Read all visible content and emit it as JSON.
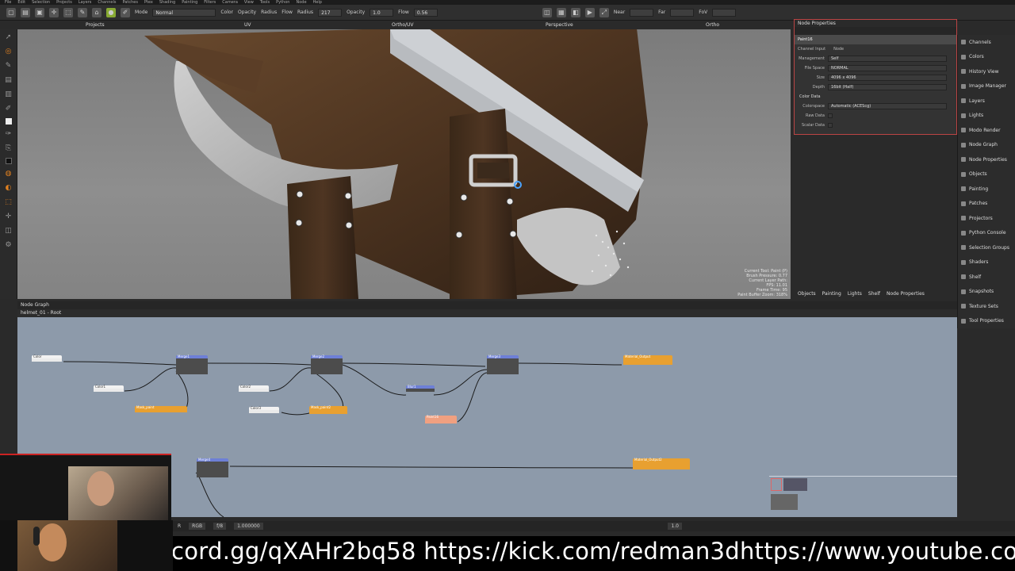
{
  "menubar": [
    "File",
    "Edit",
    "Selection",
    "Projects",
    "Layers",
    "Channels",
    "Patches",
    "Ptex",
    "Shading",
    "Painting",
    "Filters",
    "Camera",
    "View",
    "Tools",
    "Python",
    "Node",
    "Help"
  ],
  "toolbar": {
    "mode_label": "Mode",
    "mode_value": "Normal",
    "color_label": "Color",
    "opacity_label": "Opacity",
    "radius_label": "Radius",
    "flow_label": "Flow",
    "radius_value": "217",
    "opacity_value": "1.0",
    "flow_value": "0.56",
    "near_label": "Near",
    "far_label": "Far",
    "fov_label": "FoV"
  },
  "viewport_tabs": [
    "Projects",
    "UV",
    "Ortho/UV",
    "Perspective",
    "Ortho"
  ],
  "hud": [
    "Current Tool: Paint (P)",
    "Brush Pressure: 0.77",
    "Current Layer Path:",
    "FPS: 11.01",
    "Frame Time: 95",
    "Paint Buffer Zoom: 318%"
  ],
  "properties": {
    "header": "Node Properties",
    "title": "Paint16",
    "tabs": [
      "Channel Input",
      "Node"
    ],
    "rows": [
      {
        "label": "Management",
        "value": "Self"
      },
      {
        "label": "File Space",
        "value": "NORMAL"
      },
      {
        "label": "Size",
        "value": "4096 x 4096"
      },
      {
        "label": "Depth",
        "value": "16bit (Half)"
      }
    ],
    "section": "Color Data",
    "colorspace_label": "Colorspace",
    "colorspace_value": "Automatic (ACEScg)",
    "raw_data": "Raw Data",
    "scalar_data": "Scalar Data"
  },
  "shelf_tabs": [
    "Objects",
    "Painting",
    "Lights",
    "Shelf",
    "Node Properties"
  ],
  "sidebar": [
    "Channels",
    "Colors",
    "History View",
    "Image Manager",
    "Layers",
    "Lights",
    "Modo Render",
    "Node Graph",
    "Node Properties",
    "Objects",
    "Painting",
    "Patches",
    "Projectors",
    "Python Console",
    "Selection Groups",
    "Shaders",
    "Shelf",
    "Snapshots",
    "Texture Sets",
    "Tool Properties"
  ],
  "node_graph": {
    "header": "Node Graph",
    "path": "helmet_01 - Root",
    "nodes": [
      {
        "label": "Color",
        "kind": "white"
      },
      {
        "label": "Merge1",
        "kind": "blue"
      },
      {
        "label": "Merge2",
        "kind": "blue"
      },
      {
        "label": "Merge3",
        "kind": "blue"
      },
      {
        "label": "Color1",
        "kind": "white"
      },
      {
        "label": "Color2",
        "kind": "white"
      },
      {
        "label": "Color3",
        "kind": "white"
      },
      {
        "label": "Blur1",
        "kind": "blue"
      },
      {
        "label": "Paint16",
        "kind": "salmon"
      },
      {
        "label": "Merge4",
        "kind": "blue"
      },
      {
        "label": "Material_Output",
        "kind": "orange"
      },
      {
        "label": "Material_Output2",
        "kind": "orange"
      },
      {
        "label": "Mask_paint",
        "kind": "orange"
      },
      {
        "label": "Mask_paint2",
        "kind": "orange"
      }
    ]
  },
  "statusbar": {
    "channel": "RGB",
    "frame": "f/8",
    "gain": "1.000000",
    "zoom": "1.0"
  },
  "ticker": "cord.gg/qXAHr2bq58   https://kick.com/redman3dhttps://www.youtube.co"
}
